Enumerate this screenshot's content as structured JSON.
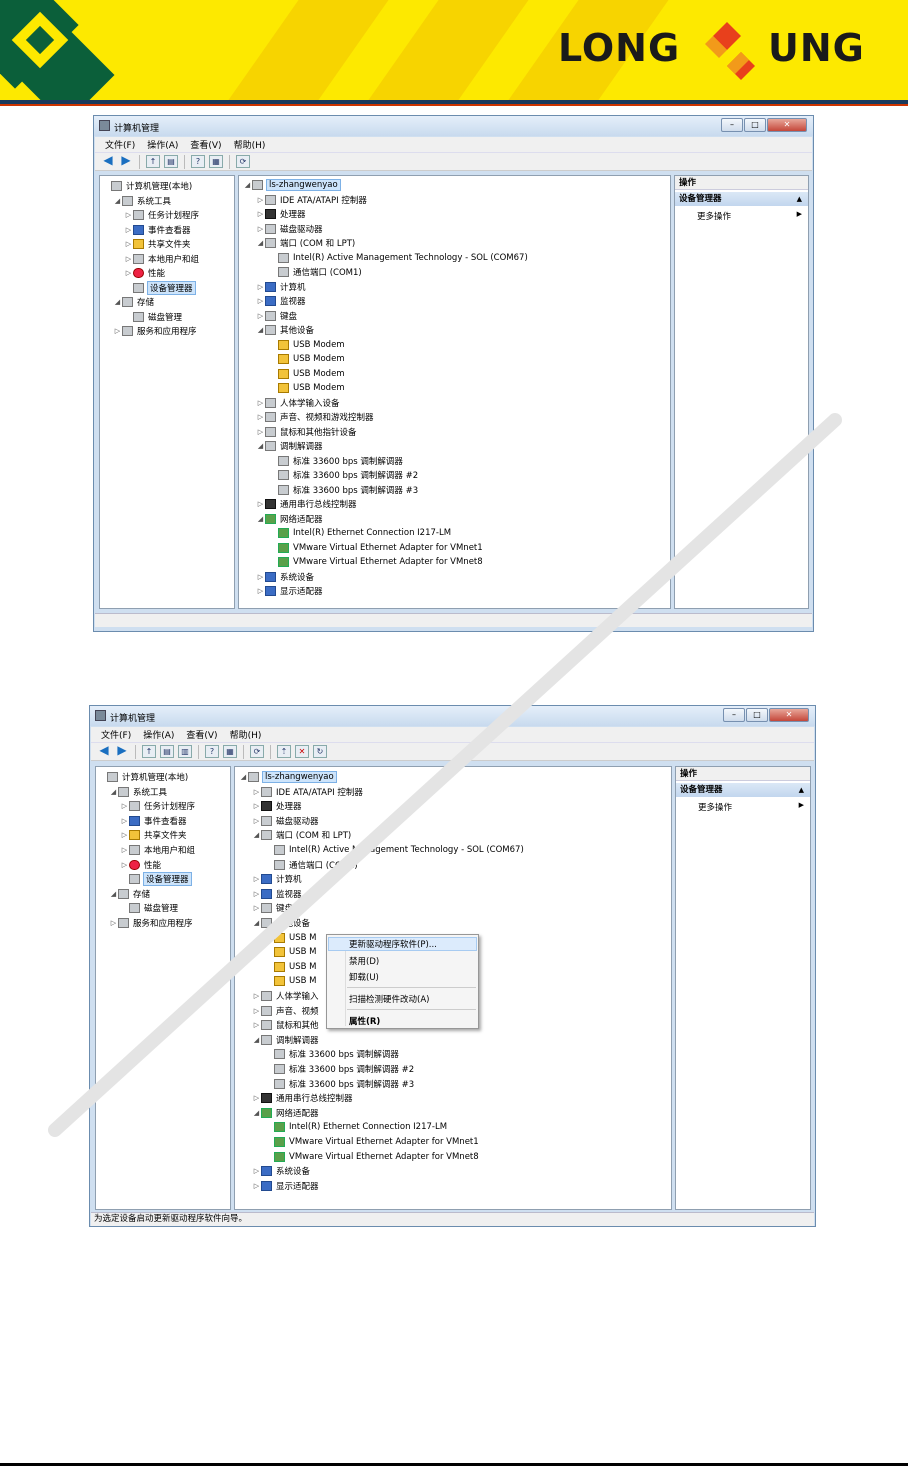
{
  "brand": {
    "left": "LONG",
    "right": "UNG"
  },
  "window1": {
    "title": "计算机管理",
    "menu": [
      "文件(F)",
      "操作(A)",
      "查看(V)",
      "帮助(H)"
    ],
    "left_tree": [
      {
        "label": "计算机管理(本地)",
        "indent": 0,
        "arrow": "",
        "icon": "gray"
      },
      {
        "label": "系统工具",
        "indent": 1,
        "arrow": "◢",
        "icon": "gray"
      },
      {
        "label": "任务计划程序",
        "indent": 2,
        "arrow": "▷",
        "icon": "gray"
      },
      {
        "label": "事件查看器",
        "indent": 2,
        "arrow": "▷",
        "icon": "blue"
      },
      {
        "label": "共享文件夹",
        "indent": 2,
        "arrow": "▷",
        "icon": "yellow"
      },
      {
        "label": "本地用户和组",
        "indent": 2,
        "arrow": "▷",
        "icon": "gray"
      },
      {
        "label": "性能",
        "indent": 2,
        "arrow": "▷",
        "icon": "red"
      },
      {
        "label": "设备管理器",
        "indent": 2,
        "arrow": "",
        "icon": "gray",
        "selected": true
      },
      {
        "label": "存储",
        "indent": 1,
        "arrow": "◢",
        "icon": "gray"
      },
      {
        "label": "磁盘管理",
        "indent": 2,
        "arrow": "",
        "icon": "gray"
      },
      {
        "label": "服务和应用程序",
        "indent": 1,
        "arrow": "▷",
        "icon": "gray"
      }
    ],
    "device_tree": [
      {
        "label": "ls-zhangwenyao",
        "indent": 0,
        "arrow": "◢",
        "icon": "gray",
        "selected": true
      },
      {
        "label": "IDE ATA/ATAPI 控制器",
        "indent": 1,
        "arrow": "▷",
        "icon": "gray"
      },
      {
        "label": "处理器",
        "indent": 1,
        "arrow": "▷",
        "icon": "dark"
      },
      {
        "label": "磁盘驱动器",
        "indent": 1,
        "arrow": "▷",
        "icon": "gray"
      },
      {
        "label": "端口 (COM 和 LPT)",
        "indent": 1,
        "arrow": "◢",
        "icon": "gray"
      },
      {
        "label": "Intel(R) Active Management Technology - SOL (COM67)",
        "indent": 2,
        "arrow": "",
        "icon": "gray"
      },
      {
        "label": "通信端口 (COM1)",
        "indent": 2,
        "arrow": "",
        "icon": "gray"
      },
      {
        "label": "计算机",
        "indent": 1,
        "arrow": "▷",
        "icon": "blue"
      },
      {
        "label": "监视器",
        "indent": 1,
        "arrow": "▷",
        "icon": "blue"
      },
      {
        "label": "键盘",
        "indent": 1,
        "arrow": "▷",
        "icon": "gray"
      },
      {
        "label": "其他设备",
        "indent": 1,
        "arrow": "◢",
        "icon": "gray"
      },
      {
        "label": "USB Modem",
        "indent": 2,
        "arrow": "",
        "icon": "yellow"
      },
      {
        "label": "USB Modem",
        "indent": 2,
        "arrow": "",
        "icon": "yellow"
      },
      {
        "label": "USB Modem",
        "indent": 2,
        "arrow": "",
        "icon": "yellow"
      },
      {
        "label": "USB Modem",
        "indent": 2,
        "arrow": "",
        "icon": "yellow"
      },
      {
        "label": "人体学输入设备",
        "indent": 1,
        "arrow": "▷",
        "icon": "gray"
      },
      {
        "label": "声音、视频和游戏控制器",
        "indent": 1,
        "arrow": "▷",
        "icon": "gray"
      },
      {
        "label": "鼠标和其他指针设备",
        "indent": 1,
        "arrow": "▷",
        "icon": "gray"
      },
      {
        "label": "调制解调器",
        "indent": 1,
        "arrow": "◢",
        "icon": "gray"
      },
      {
        "label": "标准 33600 bps 调制解调器",
        "indent": 2,
        "arrow": "",
        "icon": "gray"
      },
      {
        "label": "标准 33600 bps 调制解调器 #2",
        "indent": 2,
        "arrow": "",
        "icon": "gray"
      },
      {
        "label": "标准 33600 bps 调制解调器 #3",
        "indent": 2,
        "arrow": "",
        "icon": "gray"
      },
      {
        "label": "通用串行总线控制器",
        "indent": 1,
        "arrow": "▷",
        "icon": "dark"
      },
      {
        "label": "网络适配器",
        "indent": 1,
        "arrow": "◢",
        "icon": "green"
      },
      {
        "label": "Intel(R) Ethernet Connection I217-LM",
        "indent": 2,
        "arrow": "",
        "icon": "green"
      },
      {
        "label": "VMware Virtual Ethernet Adapter for VMnet1",
        "indent": 2,
        "arrow": "",
        "icon": "green"
      },
      {
        "label": "VMware Virtual Ethernet Adapter for VMnet8",
        "indent": 2,
        "arrow": "",
        "icon": "green"
      },
      {
        "label": "系统设备",
        "indent": 1,
        "arrow": "▷",
        "icon": "blue"
      },
      {
        "label": "显示适配器",
        "indent": 1,
        "arrow": "▷",
        "icon": "blue"
      }
    ],
    "actions": {
      "header": "操作",
      "section": "设备管理器",
      "more": "更多操作"
    }
  },
  "window2": {
    "title": "计算机管理",
    "menu": [
      "文件(F)",
      "操作(A)",
      "查看(V)",
      "帮助(H)"
    ],
    "device_tree_labels": [
      "ls-zhangwenyao",
      "IDE ATA/ATAPI 控制器",
      "处理器",
      "磁盘驱动器",
      "端口 (COM 和 LPT)",
      "Intel(R) Active Management Technology - SOL (COM67)",
      "通信端口 (COM1)",
      "计算机",
      "监视器",
      "键盘",
      "其他设备",
      "USB M",
      "USB M",
      "USB M",
      "USB M",
      "人体学输入",
      "声音、视频",
      "鼠标和其他",
      "调制解调器",
      "标准 33600 bps 调制解调器",
      "标准 33600 bps 调制解调器 #2",
      "标准 33600 bps 调制解调器 #3",
      "通用串行总线控制器",
      "网络适配器",
      "Intel(R) Ethernet Connection I217-LM",
      "VMware Virtual Ethernet Adapter for VMnet1",
      "VMware Virtual Ethernet Adapter for VMnet8",
      "系统设备",
      "显示适配器"
    ],
    "context_menu": {
      "update_driver": "更新驱动程序软件(P)...",
      "disable": "禁用(D)",
      "uninstall": "卸载(U)",
      "scan": "扫描检测硬件改动(A)",
      "properties": "属性(R)"
    },
    "actions": {
      "header": "操作",
      "section": "设备管理器",
      "more": "更多操作"
    },
    "status": "为选定设备启动更新驱动程序软件向导。"
  }
}
